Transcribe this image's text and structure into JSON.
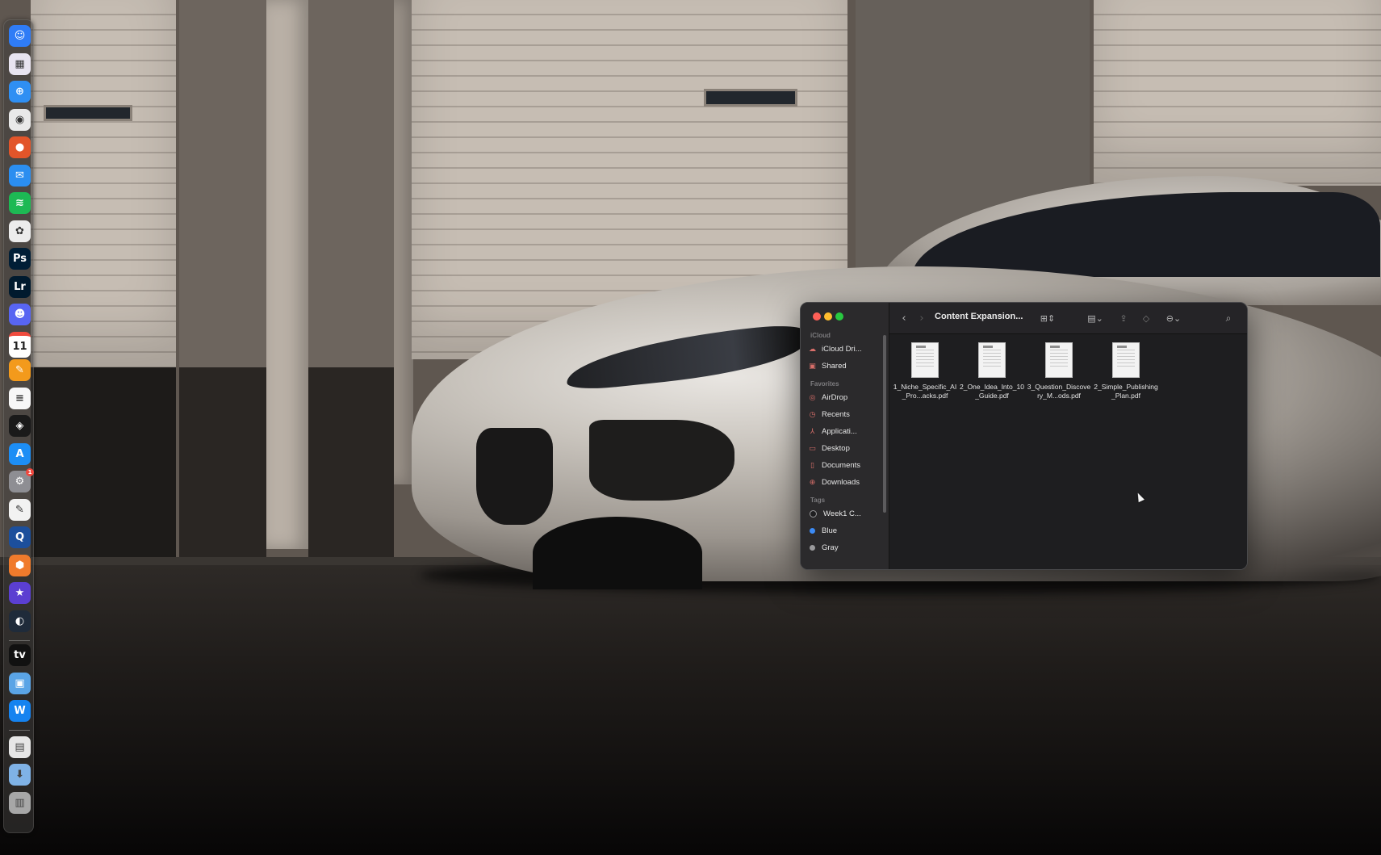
{
  "dock": {
    "apps": [
      {
        "name": "finder",
        "glyph": "☺",
        "bg": "#2f7cf6"
      },
      {
        "name": "launchpad",
        "glyph": "▦",
        "bg": "#e8e4f0"
      },
      {
        "name": "safari",
        "glyph": "⊕",
        "bg": "#2f8ff3"
      },
      {
        "name": "chrome",
        "glyph": "◉",
        "bg": "#e9e9e9"
      },
      {
        "name": "firefox",
        "glyph": "●",
        "bg": "#e2552a"
      },
      {
        "name": "mail",
        "glyph": "✉",
        "bg": "#2b8ef0"
      },
      {
        "name": "spotify",
        "glyph": "≋",
        "bg": "#1db954"
      },
      {
        "name": "chatgpt",
        "glyph": "✿",
        "bg": "#ececec"
      },
      {
        "name": "photoshop",
        "glyph": "Ps",
        "bg": "#001e36"
      },
      {
        "name": "lightroom",
        "glyph": "Lr",
        "bg": "#001a2e"
      },
      {
        "name": "discord",
        "glyph": "☻",
        "bg": "#5865f2"
      },
      {
        "name": "calendar",
        "glyph": "11",
        "bg": "#ffffff"
      },
      {
        "name": "pages",
        "glyph": "✎",
        "bg": "#f39a1c"
      },
      {
        "name": "notes",
        "glyph": "≡",
        "bg": "#f7f7f7"
      },
      {
        "name": "capcut",
        "glyph": "◈",
        "bg": "#1a1a1a"
      },
      {
        "name": "app-store",
        "glyph": "A",
        "bg": "#1d8ef5"
      },
      {
        "name": "system-settings",
        "glyph": "⚙",
        "bg": "#8e8e93"
      },
      {
        "name": "textedit",
        "glyph": "✎",
        "bg": "#f2f2f2"
      },
      {
        "name": "quicktime",
        "glyph": "Q",
        "bg": "#1c4f9c"
      },
      {
        "name": "blender",
        "glyph": "⬢",
        "bg": "#f07b2c"
      },
      {
        "name": "imovie",
        "glyph": "★",
        "bg": "#5b3fd1"
      },
      {
        "name": "davinci-resolve",
        "glyph": "◐",
        "bg": "#1f2b3a"
      },
      {
        "name": "apple-tv",
        "glyph": "tv",
        "bg": "#111111"
      },
      {
        "name": "preview",
        "glyph": "▣",
        "bg": "#5aa4e6"
      },
      {
        "name": "wordsmith",
        "glyph": "W",
        "bg": "#1583f0"
      }
    ],
    "calendar_day": "11",
    "settings_badge": "1",
    "recent": [
      {
        "name": "document",
        "glyph": "▤",
        "bg": "#e6e6e6"
      },
      {
        "name": "downloads-folder",
        "glyph": "⬇",
        "bg": "#7fb2e6"
      },
      {
        "name": "trash",
        "glyph": "▥",
        "bg": "#a7a7a7"
      }
    ]
  },
  "finder": {
    "title": "Content Expansion...",
    "sidebar": {
      "sections": [
        {
          "label": "iCloud",
          "items": [
            {
              "label": "iCloud Dri...",
              "icon": "cloud-icon",
              "glyph": "☁"
            },
            {
              "label": "Shared",
              "icon": "shared-folder-icon",
              "glyph": "▣"
            }
          ]
        },
        {
          "label": "Favorites",
          "items": [
            {
              "label": "AirDrop",
              "icon": "airdrop-icon",
              "glyph": "◎"
            },
            {
              "label": "Recents",
              "icon": "clock-icon",
              "glyph": "◷"
            },
            {
              "label": "Applicati...",
              "icon": "applications-icon",
              "glyph": "⅄"
            },
            {
              "label": "Desktop",
              "icon": "desktop-icon",
              "glyph": "▭"
            },
            {
              "label": "Documents",
              "icon": "document-icon",
              "glyph": "▯"
            },
            {
              "label": "Downloads",
              "icon": "download-icon",
              "glyph": "⊕"
            }
          ]
        },
        {
          "label": "Tags",
          "items": [
            {
              "label": "Week1 C...",
              "color": "#1e1e20"
            },
            {
              "label": "Blue",
              "color": "#3c8bf5"
            },
            {
              "label": "Gray",
              "color": "#9a9a9c"
            }
          ]
        }
      ]
    },
    "files": [
      {
        "name": "1_Niche_Specific_AI_Pro...acks.pdf"
      },
      {
        "name": "2_One_Idea_Into_10_Guide.pdf"
      },
      {
        "name": "3_Question_Discovery_M...ods.pdf"
      },
      {
        "name": "2_Simple_Publishing_Plan.pdf"
      }
    ]
  }
}
